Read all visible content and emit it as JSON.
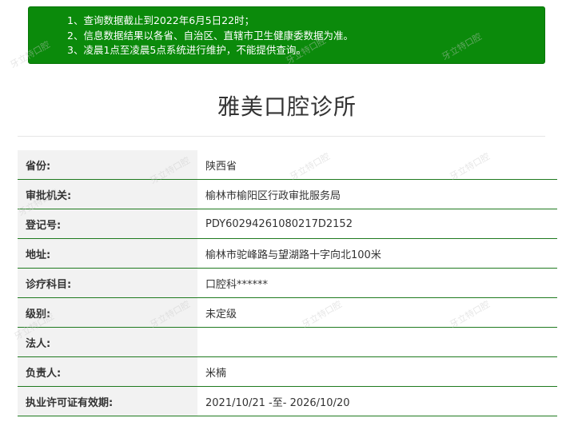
{
  "notice": {
    "lines": [
      "1、查询数据截止到2022年6月5日22时；",
      "2、信息数据结果以各省、自治区、直辖市卫生健康委数据为准。",
      "3、凌晨1点至凌晨5点系统进行维护，不能提供查询。"
    ]
  },
  "title": "雅美口腔诊所",
  "rows": [
    {
      "label": "省份:",
      "value": "陕西省"
    },
    {
      "label": "审批机关:",
      "value": "榆林市榆阳区行政审批服务局"
    },
    {
      "label": "登记号:",
      "value": "PDY60294261080217D2152"
    },
    {
      "label": "地址:",
      "value": "榆林市驼峰路与望湖路十字向北100米"
    },
    {
      "label": "诊疗科目:",
      "value": "口腔科******"
    },
    {
      "label": "级别:",
      "value": "未定级"
    },
    {
      "label": "法人:",
      "value": ""
    },
    {
      "label": "负责人:",
      "value": "米楠"
    },
    {
      "label": "执业许可证有效期:",
      "value": "2021/10/21 -至- 2026/10/20"
    }
  ],
  "watermark": "牙立特口腔"
}
